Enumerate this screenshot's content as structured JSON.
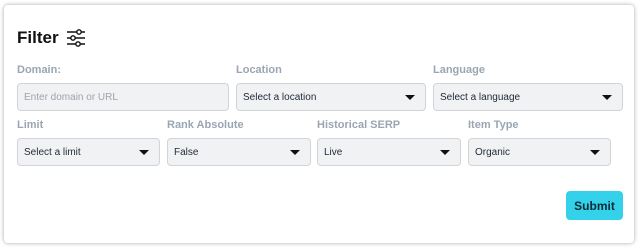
{
  "filter": {
    "title": "Filter",
    "icon": "sliders-icon"
  },
  "fields": {
    "domain": {
      "label": "Domain:",
      "placeholder": "Enter domain or URL"
    },
    "location": {
      "label": "Location",
      "value": "Select a location"
    },
    "language": {
      "label": "Language",
      "value": "Select a language"
    },
    "limit": {
      "label": "Limit",
      "value": "Select a limit"
    },
    "rank_absolute": {
      "label": "Rank Absolute",
      "value": "False"
    },
    "historical_serp": {
      "label": "Historical SERP",
      "value": "Live"
    },
    "item_type": {
      "label": "Item Type",
      "value": "Organic"
    }
  },
  "actions": {
    "submit_label": "Submit"
  },
  "colors": {
    "accent": "#33d2ea",
    "label": "#9aa6b2",
    "field_bg": "#f1f2f3"
  }
}
